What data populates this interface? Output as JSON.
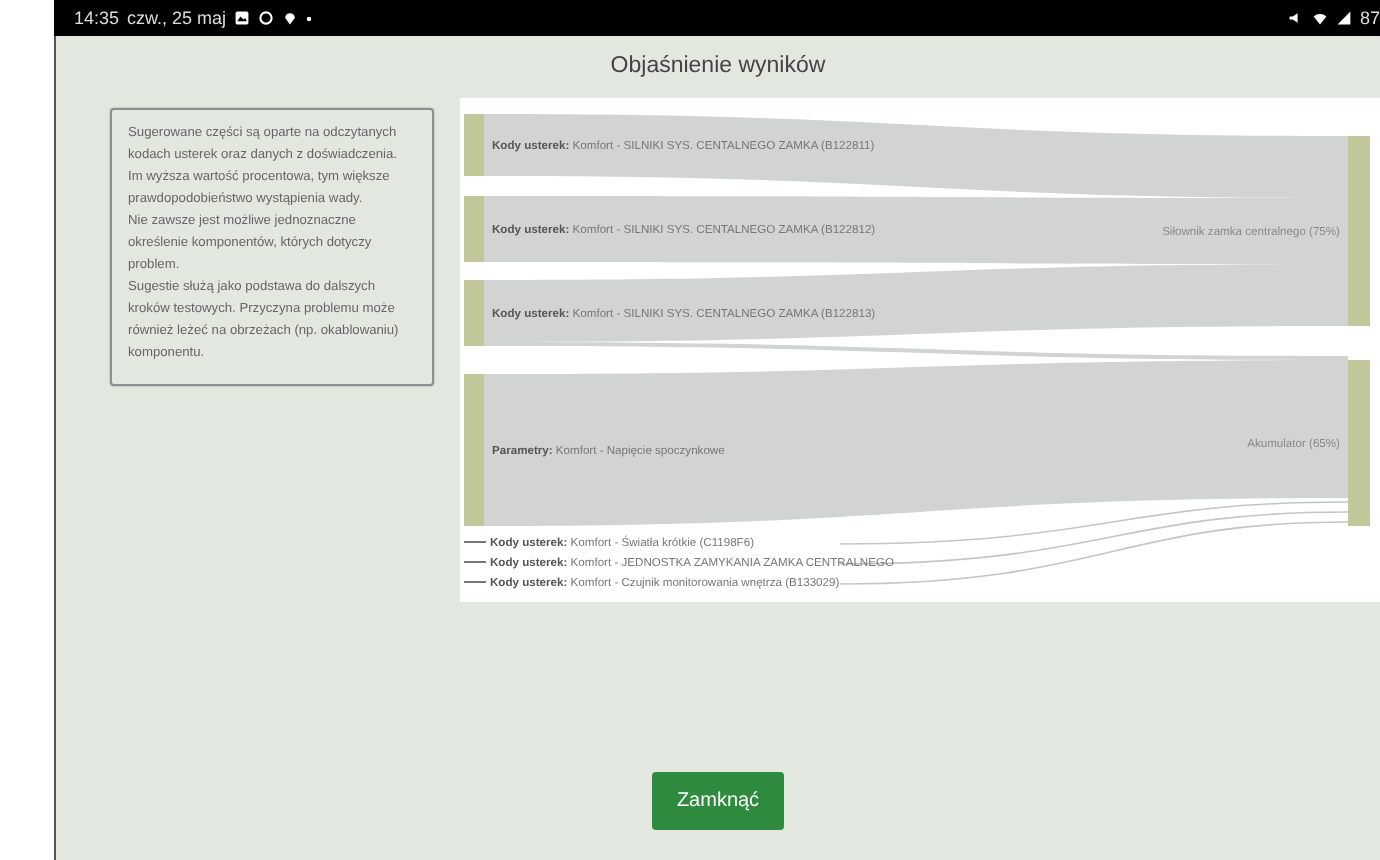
{
  "status_bar": {
    "time": "14:35",
    "date": "czw., 25 maj",
    "battery": "87"
  },
  "window": {
    "title": "Objaśnienie wyników"
  },
  "info": {
    "paragraphs": [
      "Sugerowane części są oparte na odczytanych kodach usterek oraz danych z doświadczenia.",
      "Im wyższa wartość procentowa, tym większe prawdopodobieństwo wystąpienia wady.",
      "Nie zawsze jest możliwe jednoznaczne określenie komponentów, których dotyczy problem.",
      "Sugestie służą jako podstawa do dalszych kroków testowych. Przyczyna problemu może również leżeć na obrzeżach (np. okablowaniu) komponentu."
    ]
  },
  "diagram": {
    "sources": [
      {
        "kind": "node",
        "category": "Kody usterek:",
        "text": "Komfort - SILNIKI SYS. CENTALNEGO ZAMKA (B122811)"
      },
      {
        "kind": "node",
        "category": "Kody usterek:",
        "text": "Komfort - SILNIKI SYS. CENTALNEGO ZAMKA (B122812)"
      },
      {
        "kind": "node",
        "category": "Kody usterek:",
        "text": "Komfort - SILNIKI SYS. CENTALNEGO ZAMKA (B122813)"
      },
      {
        "kind": "node",
        "category": "Parametry:",
        "text": "Komfort - Napięcie spoczynkowe"
      },
      {
        "kind": "leader",
        "category": "Kody usterek:",
        "text": "Komfort - Światła krótkie (C1198F6)"
      },
      {
        "kind": "leader",
        "category": "Kody usterek:",
        "text": "Komfort - JEDNOSTKA ZAMYKANIA ZAMKA CENTRALNEGO"
      },
      {
        "kind": "leader",
        "category": "Kody usterek:",
        "text": "Komfort - Czujnik monitorowania wnętrza (B133029)"
      }
    ],
    "targets": [
      "Siłownik zamka centralnego (75%)",
      "Akumulator (65%)"
    ]
  },
  "buttons": [
    "Zamknąć"
  ]
}
